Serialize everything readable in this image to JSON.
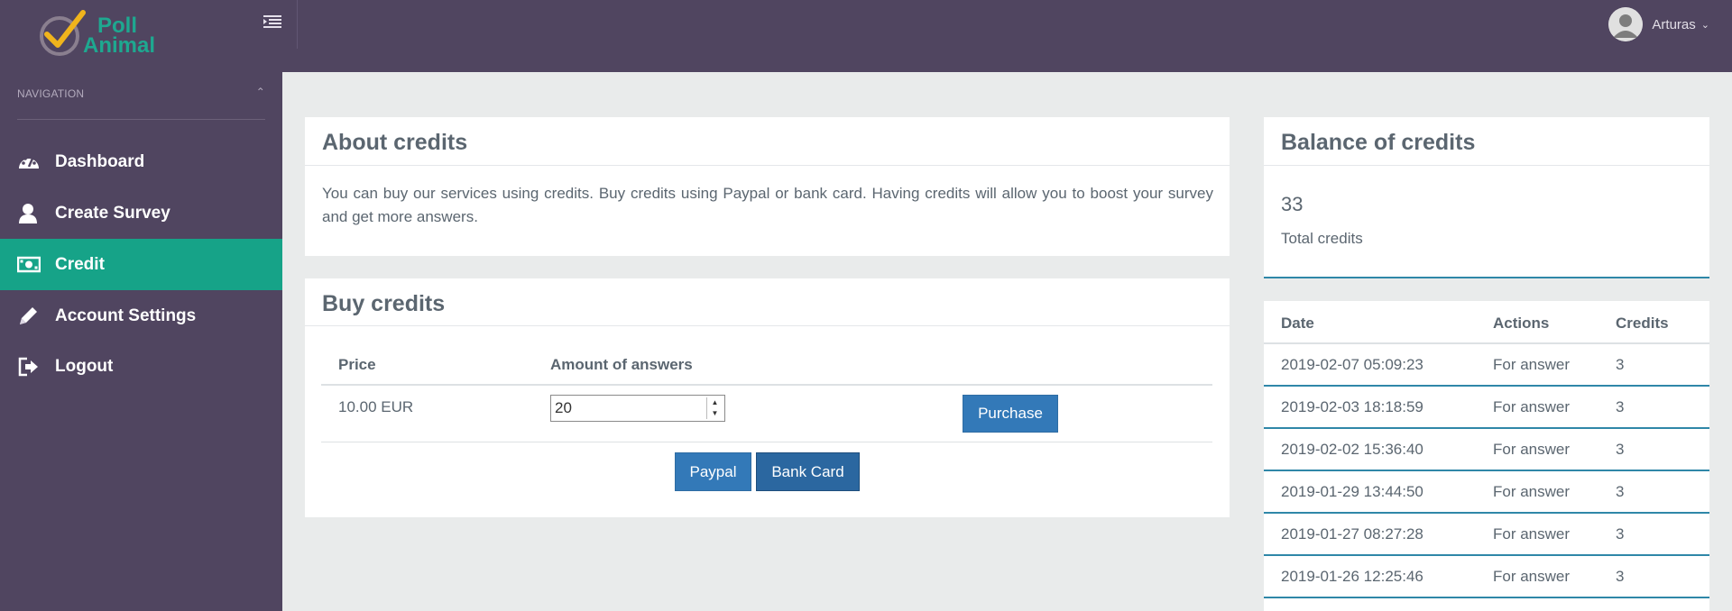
{
  "app": {
    "logo_line1": "Poll",
    "logo_line2": "Animal",
    "user_name": "Arturas"
  },
  "sidebar": {
    "header": "NAVIGATION",
    "items": [
      {
        "label": "Dashboard",
        "icon": "dashboard-icon"
      },
      {
        "label": "Create Survey",
        "icon": "user-icon"
      },
      {
        "label": "Credit",
        "icon": "money-icon",
        "active": true
      },
      {
        "label": "Account Settings",
        "icon": "pencil-icon"
      },
      {
        "label": "Logout",
        "icon": "logout-icon"
      }
    ]
  },
  "about": {
    "title": "About credits",
    "text": "You can buy our services using credits. Buy credits using Paypal or bank card. Having credits will allow you to boost your survey and get more answers."
  },
  "buy": {
    "title": "Buy credits",
    "col_price": "Price",
    "col_amount": "Amount of answers",
    "price": "10.00 EUR",
    "amount": "20",
    "purchase_label": "Purchase",
    "paypal_label": "Paypal",
    "bank_card_label": "Bank Card"
  },
  "balance": {
    "title": "Balance of credits",
    "total": "33",
    "total_label": "Total credits"
  },
  "history": {
    "col_date": "Date",
    "col_actions": "Actions",
    "col_credits": "Credits",
    "rows": [
      {
        "date": "2019-02-07 05:09:23",
        "action": "For answer",
        "credits": "3"
      },
      {
        "date": "2019-02-03 18:18:59",
        "action": "For answer",
        "credits": "3"
      },
      {
        "date": "2019-02-02 15:36:40",
        "action": "For answer",
        "credits": "3"
      },
      {
        "date": "2019-01-29 13:44:50",
        "action": "For answer",
        "credits": "3"
      },
      {
        "date": "2019-01-27 08:27:28",
        "action": "For answer",
        "credits": "3"
      },
      {
        "date": "2019-01-26 12:25:46",
        "action": "For answer",
        "credits": "3"
      }
    ]
  },
  "colors": {
    "topbar": "#504560",
    "accent": "#16a388",
    "button": "#3379b8"
  }
}
